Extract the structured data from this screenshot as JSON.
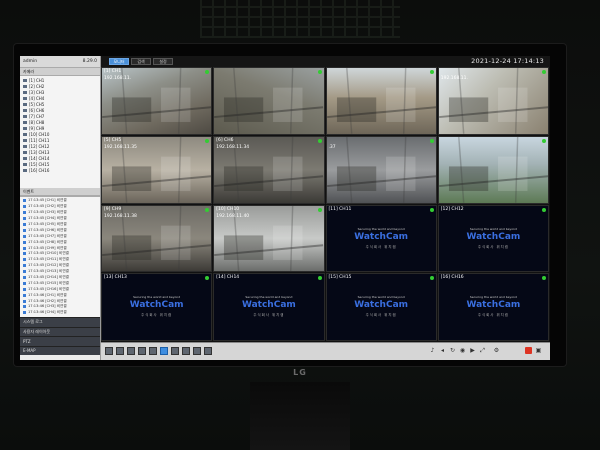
{
  "sidebar": {
    "user": "admin",
    "version": "8.29.0",
    "camera_section_title": "카메라",
    "cameras": [
      "[1] CH1",
      "[2] CH2",
      "[3] CH3",
      "[4] CH4",
      "[5] CH5",
      "[6] CH6",
      "[7] CH7",
      "[8] CH8",
      "[9] CH9",
      "[10] CH10",
      "[11] CH11",
      "[12] CH12",
      "[13] CH13",
      "[14] CH14",
      "[15] CH15",
      "[16] CH16"
    ],
    "event_section_title": "이벤트",
    "events": [
      "17:13:45 [CH1] 비연결",
      "17:13:45 [CH2] 비연결",
      "17:13:45 [CH3] 비연결",
      "17:13:45 [CH4] 비연결",
      "17:13:45 [CH5] 비연결",
      "17:13:45 [CH6] 비연결",
      "17:13:45 [CH7] 비연결",
      "17:13:45 [CH8] 비연결",
      "17:13:45 [CH9] 비연결",
      "17:13:45 [CH10] 비연결",
      "17:13:45 [CH11] 비연결",
      "17:13:45 [CH12] 비연결",
      "17:13:45 [CH13] 비연결",
      "17:13:45 [CH14] 비연결",
      "17:13:45 [CH15] 비연결",
      "17:13:45 [CH16] 비연결",
      "17:13:46 [CH1] 비연결",
      "17:13:46 [CH2] 비연결",
      "17:13:46 [CH3] 비연결",
      "17:13:46 [CH4] 비연결"
    ],
    "panels": [
      "시스템 로그",
      "사용자 레이아웃",
      "PTZ",
      "E-MAP"
    ]
  },
  "topbar": {
    "tabs": [
      "모니터",
      "검색",
      "설정"
    ],
    "active_tab": 0,
    "datetime": "2021-12-24 17:14:13"
  },
  "tiles": [
    {
      "label": "[1] CH1",
      "ip": "192.168.11.",
      "signal": true,
      "scene": "site1"
    },
    {
      "label": "",
      "ip": "",
      "signal": true,
      "scene": "site2"
    },
    {
      "label": "",
      "ip": "",
      "signal": true,
      "scene": "site3"
    },
    {
      "label": "",
      "ip": "192.168.11.",
      "signal": true,
      "scene": "site4"
    },
    {
      "label": "[5] CH5",
      "ip": "192.168.11.35",
      "signal": true,
      "scene": "indoor1"
    },
    {
      "label": "[6] CH6",
      "ip": "192.168.11.34",
      "signal": true,
      "scene": "indoor2"
    },
    {
      "label": "",
      "ip": ".37",
      "signal": true,
      "scene": "indoor3"
    },
    {
      "label": "",
      "ip": "",
      "signal": true,
      "scene": "outdoor"
    },
    {
      "label": "[9] CH9",
      "ip": "192.168.11.38",
      "signal": true,
      "scene": "room"
    },
    {
      "label": "[10] CH10",
      "ip": "192.168.11.40",
      "signal": true,
      "scene": "scaffold"
    },
    {
      "label": "[11] CH11",
      "ip": "",
      "signal": false,
      "scene": "none"
    },
    {
      "label": "[12] CH12",
      "ip": "",
      "signal": false,
      "scene": "none"
    },
    {
      "label": "[13] CH13",
      "ip": "",
      "signal": false,
      "scene": "none"
    },
    {
      "label": "[14] CH14",
      "ip": "",
      "signal": false,
      "scene": "none"
    },
    {
      "label": "[15] CH15",
      "ip": "",
      "signal": false,
      "scene": "none"
    },
    {
      "label": "[16] CH16",
      "ip": "",
      "signal": false,
      "scene": "none"
    }
  ],
  "nosignal": {
    "tagline": "Securing the world and beyond",
    "brand": "WatchCam",
    "subtitle": "주식회사 위치캠"
  },
  "bottombar": {
    "layout_buttons": [
      "1x1",
      "2x2",
      "1+5",
      "1+7",
      "3x3",
      "4x4",
      "5x5",
      "6x6",
      "1+12",
      "other"
    ],
    "active_layout": 5
  },
  "monitor_brand": "LG",
  "colors": {
    "accent": "#4a90d9",
    "signal_dot": "#33cc33",
    "brand_blue": "#3a6fe0"
  }
}
